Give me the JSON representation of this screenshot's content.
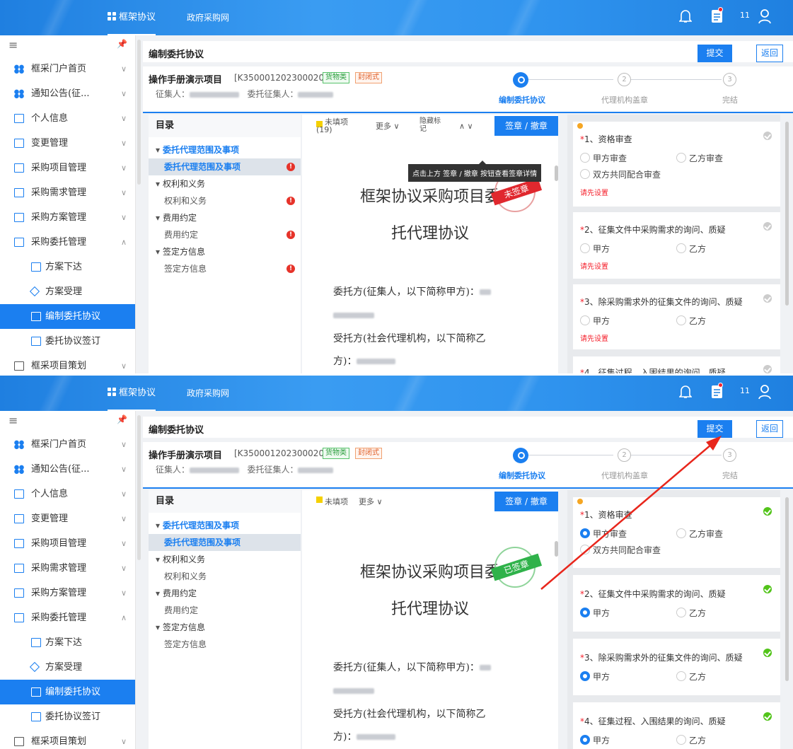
{
  "top": {
    "nav_main": "框架协议",
    "nav_gov": "政府采购网",
    "msg_count": "11"
  },
  "sidebar": {
    "items": [
      {
        "label": "框采门户首页",
        "icon": "portal-icon"
      },
      {
        "label": "通知公告(征...",
        "icon": "notice-icon"
      },
      {
        "label": "个人信息",
        "icon": "person-icon"
      },
      {
        "label": "变更管理",
        "icon": "change-icon"
      },
      {
        "label": "采购项目管理",
        "icon": "project-icon"
      },
      {
        "label": "采购需求管理",
        "icon": "demand-icon"
      },
      {
        "label": "采购方案管理",
        "icon": "plan-icon"
      },
      {
        "label": "采购委托管理",
        "icon": "entrust-icon"
      },
      {
        "label": "方案下达",
        "icon": "issue-icon"
      },
      {
        "label": "方案受理",
        "icon": "accept-icon"
      },
      {
        "label": "编制委托协议",
        "icon": "edit-icon"
      },
      {
        "label": "委托协议签订",
        "icon": "sign-icon"
      },
      {
        "label": "框采项目策划",
        "icon": "folder-icon"
      }
    ]
  },
  "page": {
    "title": "编制委托协议",
    "submit": "提交",
    "back": "返回",
    "project_name": "操作手册演示项目",
    "project_code": "[K3500012023000205]",
    "tag_goods": "货物类",
    "tag_closed": "封闭式",
    "collector_label": "征集人：",
    "entrust_label": "委托征集人："
  },
  "steps": [
    "编制委托协议",
    "代理机构盖章",
    "完结"
  ],
  "step_nums": [
    "2",
    "3"
  ],
  "toc": {
    "title": "目录",
    "sections": [
      {
        "name": "委托代理范围及事项",
        "item": "委托代理范围及事项"
      },
      {
        "name": "权利和义务",
        "item": "权利和义务"
      },
      {
        "name": "费用约定",
        "item": "费用约定"
      },
      {
        "name": "签定方信息",
        "item": "签定方信息"
      }
    ],
    "warn_glyph": "!"
  },
  "doc": {
    "unfilled": "未填项",
    "unfilled_count": "(19)",
    "more": "更多 ∨",
    "hide_marks_1": "隐藏标",
    "hide_marks_2": "记",
    "nav_arrows": "∧  ∨",
    "sign_btn": "签章 / 撤章",
    "tooltip": "点击上方 签章 / 撤章 按钮查看签章详情",
    "title_1": "框架协议采购项目委",
    "title_2": "托代理协议",
    "para_1": "委托方(征集人，以下简称甲方)：",
    "para_2": "受托方(社会代理机构，以下简称乙",
    "para_3": "方)：",
    "stamp_unsigned": "未签章",
    "stamp_signed": "已签章"
  },
  "questions": [
    {
      "num": "1、",
      "text": "资格审查",
      "opts": [
        "甲方审查",
        "乙方审查",
        "双方共同配合审查"
      ]
    },
    {
      "num": "2、",
      "text": "征集文件中采购需求的询问、质疑",
      "opts": [
        "甲方",
        "乙方"
      ]
    },
    {
      "num": "3、",
      "text": "除采购需求外的征集文件的询问、质疑",
      "opts": [
        "甲方",
        "乙方"
      ]
    },
    {
      "num": "4、",
      "text": "征集过程、入围结果的询问、质疑",
      "opts": [
        "甲方",
        "乙方"
      ]
    }
  ],
  "hint": "请先设置",
  "required_mark": "*",
  "colors": {
    "primary": "#1b7ff0",
    "danger": "#f5222d",
    "success": "#52c41a",
    "arrow": "#e8261c"
  }
}
